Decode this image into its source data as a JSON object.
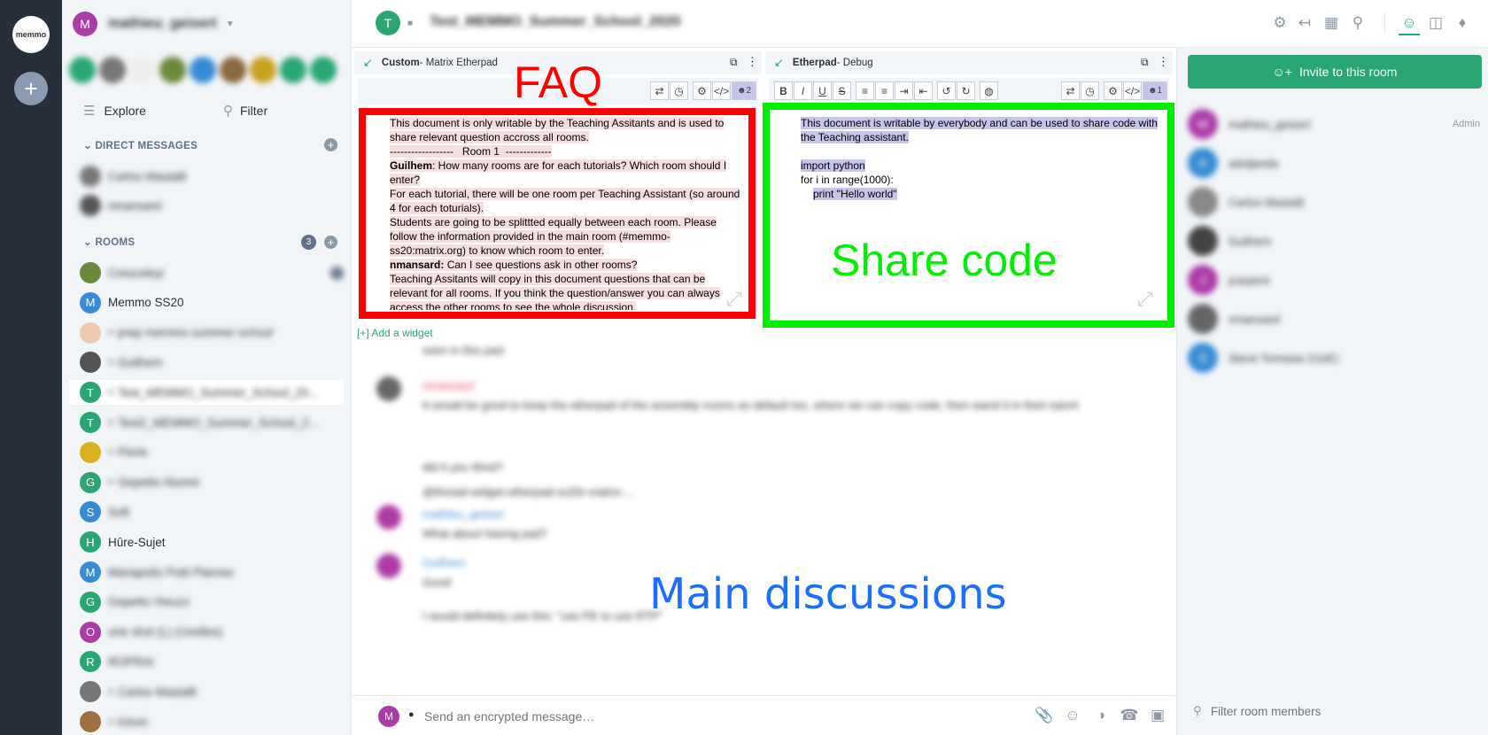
{
  "rail": {
    "logo_text": "memmo",
    "add_space": "+"
  },
  "sidebar": {
    "user_name": "mathieu_geisert",
    "explore_label": "Explore",
    "filter_label": "Filter",
    "dm_header": "DIRECT MESSAGES",
    "dms": [
      {
        "label": "Carlos Mastalli",
        "color": "#777"
      },
      {
        "label": "nmansard",
        "color": "#555"
      }
    ],
    "rooms_header": "ROOMS",
    "rooms_count": "3",
    "rooms": [
      {
        "letter": "",
        "label": "Cresceleyi",
        "color": "#6b8a3a",
        "lock": false,
        "blur": true,
        "badge": "7"
      },
      {
        "letter": "M",
        "label": "Memmo SS20",
        "color": "#368bd6",
        "lock": false,
        "blur": false
      },
      {
        "letter": "",
        "label": "prep memmo summer school",
        "color": "#f0c8b0",
        "lock": true,
        "blur": true
      },
      {
        "letter": "",
        "label": "Guilhem",
        "color": "#555",
        "lock": true,
        "blur": true
      },
      {
        "letter": "T",
        "label": "Test_MEMMO_Summer_School_20...",
        "color": "#2aa674",
        "lock": true,
        "blur": true,
        "selected": true
      },
      {
        "letter": "T",
        "label": "Test2_MEMMO_Summer_School_2...",
        "color": "#2aa674",
        "lock": true,
        "blur": true
      },
      {
        "letter": "",
        "label": "Florie",
        "color": "#d8b020",
        "lock": true,
        "blur": true
      },
      {
        "letter": "G",
        "label": "Gepetto Alumni",
        "color": "#2aa674",
        "lock": true,
        "blur": true
      },
      {
        "letter": "S",
        "label": "Soft",
        "color": "#368bd6",
        "lock": false,
        "blur": true
      },
      {
        "letter": "H",
        "label": "Hûre-Sujet",
        "color": "#2aa674",
        "lock": false,
        "blur": false
      },
      {
        "letter": "M",
        "label": "Mariapolis Potti Planner",
        "color": "#368bd6",
        "lock": false,
        "blur": true
      },
      {
        "letter": "G",
        "label": "Gepetto Vieuzz",
        "color": "#2aa674",
        "lock": false,
        "blur": true
      },
      {
        "letter": "O",
        "label": "one shot (L) (Uvelles)",
        "color": "#ac3ba8",
        "lock": false,
        "blur": true
      },
      {
        "letter": "R",
        "label": "ROPRAI",
        "color": "#2aa674",
        "lock": false,
        "blur": true
      },
      {
        "letter": "",
        "label": "Carlos Mastalli",
        "color": "#777",
        "lock": true,
        "blur": true
      },
      {
        "letter": "",
        "label": "Kévin",
        "color": "#a07040",
        "lock": true,
        "blur": true
      }
    ]
  },
  "header": {
    "room_name": "Test_MEMMO_Summer_School_2020"
  },
  "widget_left": {
    "title_bold": "Custom",
    "title_rest": " - Matrix Etherpad",
    "users": "2",
    "lines": [
      "This document is only writable by the Teaching Assitants and is used to share relevant question accross all rooms.",
      "------------------   Room 1  -------------"
    ],
    "q1_name": "Guilhem",
    "q1_text": ": How many rooms are for each tutorials? Which room should I enter?",
    "a1": "For each tutorial, there will be one room per Teaching Assistant (so around 4 for each toturials).",
    "a1b": "Students are going to be splittted equally between each room. Please follow the information provided in the main room (#memmo-ss20:matrix.org) to know which room to enter.",
    "q2_name": "nmansard:",
    "q2_text": " Can I see questions ask in other rooms?",
    "a2": "Teaching Assitants will copy in this document questions that can be relevant for all rooms. If you think the question/answer you can always access the other rooms to see the whole discussion."
  },
  "widget_right": {
    "title_bold": "Etherpad",
    "title_rest": " - Debug",
    "users": "1",
    "line1": "This document is writable by everybody and can be used to share code with the Teaching assistant.",
    "code1": "import python",
    "code2": "for i in range(1000):",
    "code3": "print \"Hello world\""
  },
  "add_widget": "[+] Add a widget",
  "annotations": {
    "faq": "FAQ",
    "share": "Share code",
    "main": "Main discussions"
  },
  "timeline": [
    {
      "name": "",
      "text": "seen in this pad.",
      "color": ""
    },
    {
      "name": "nmansard",
      "text": "It would be good to keep the etherpad of the assembly rooms as default too, where we can copy code, then wand it in their tutoril",
      "color": "#e8456a"
    },
    {
      "name": "",
      "text": "did it yes /thnd?",
      "color": ""
    },
    {
      "name": "",
      "text": "@thread-widget-etherpad-ss20r-matrix-...",
      "color": ""
    },
    {
      "name": "mathieu_geisert",
      "text": "What about having pad?",
      "color": "#368bd6"
    },
    {
      "name": "Guilhem",
      "text": "Good",
      "color": "#368bd6"
    },
    {
      "name": "",
      "text": "I would definitely use this: \"use PE to use RTP\"",
      "color": ""
    }
  ],
  "composer": {
    "placeholder": "Send an encrypted message…"
  },
  "right": {
    "invite_label": "Invite to this room",
    "members": [
      {
        "letter": "M",
        "name": "mathieu_geisert",
        "color": "#ac3ba8",
        "role": "Admin"
      },
      {
        "letter": "A",
        "name": "adoljanda",
        "color": "#368bd6",
        "role": ""
      },
      {
        "letter": "",
        "name": "Carlos Mastalli",
        "color": "#888",
        "role": ""
      },
      {
        "letter": "",
        "name": "Guilhem",
        "color": "#444",
        "role": ""
      },
      {
        "letter": "J",
        "name": "jcarpent",
        "color": "#ac3ba8",
        "role": ""
      },
      {
        "letter": "",
        "name": "nmansard",
        "color": "#666",
        "role": ""
      },
      {
        "letter": "S",
        "name": "Steve Tonneau (UoE)",
        "color": "#368bd6",
        "role": ""
      }
    ],
    "filter_placeholder": "Filter room members"
  },
  "colors": {
    "accent": "#2aa674",
    "faq_box": "#ff0000",
    "share_box": "#00ee00",
    "main_text": "#1a6fff"
  }
}
